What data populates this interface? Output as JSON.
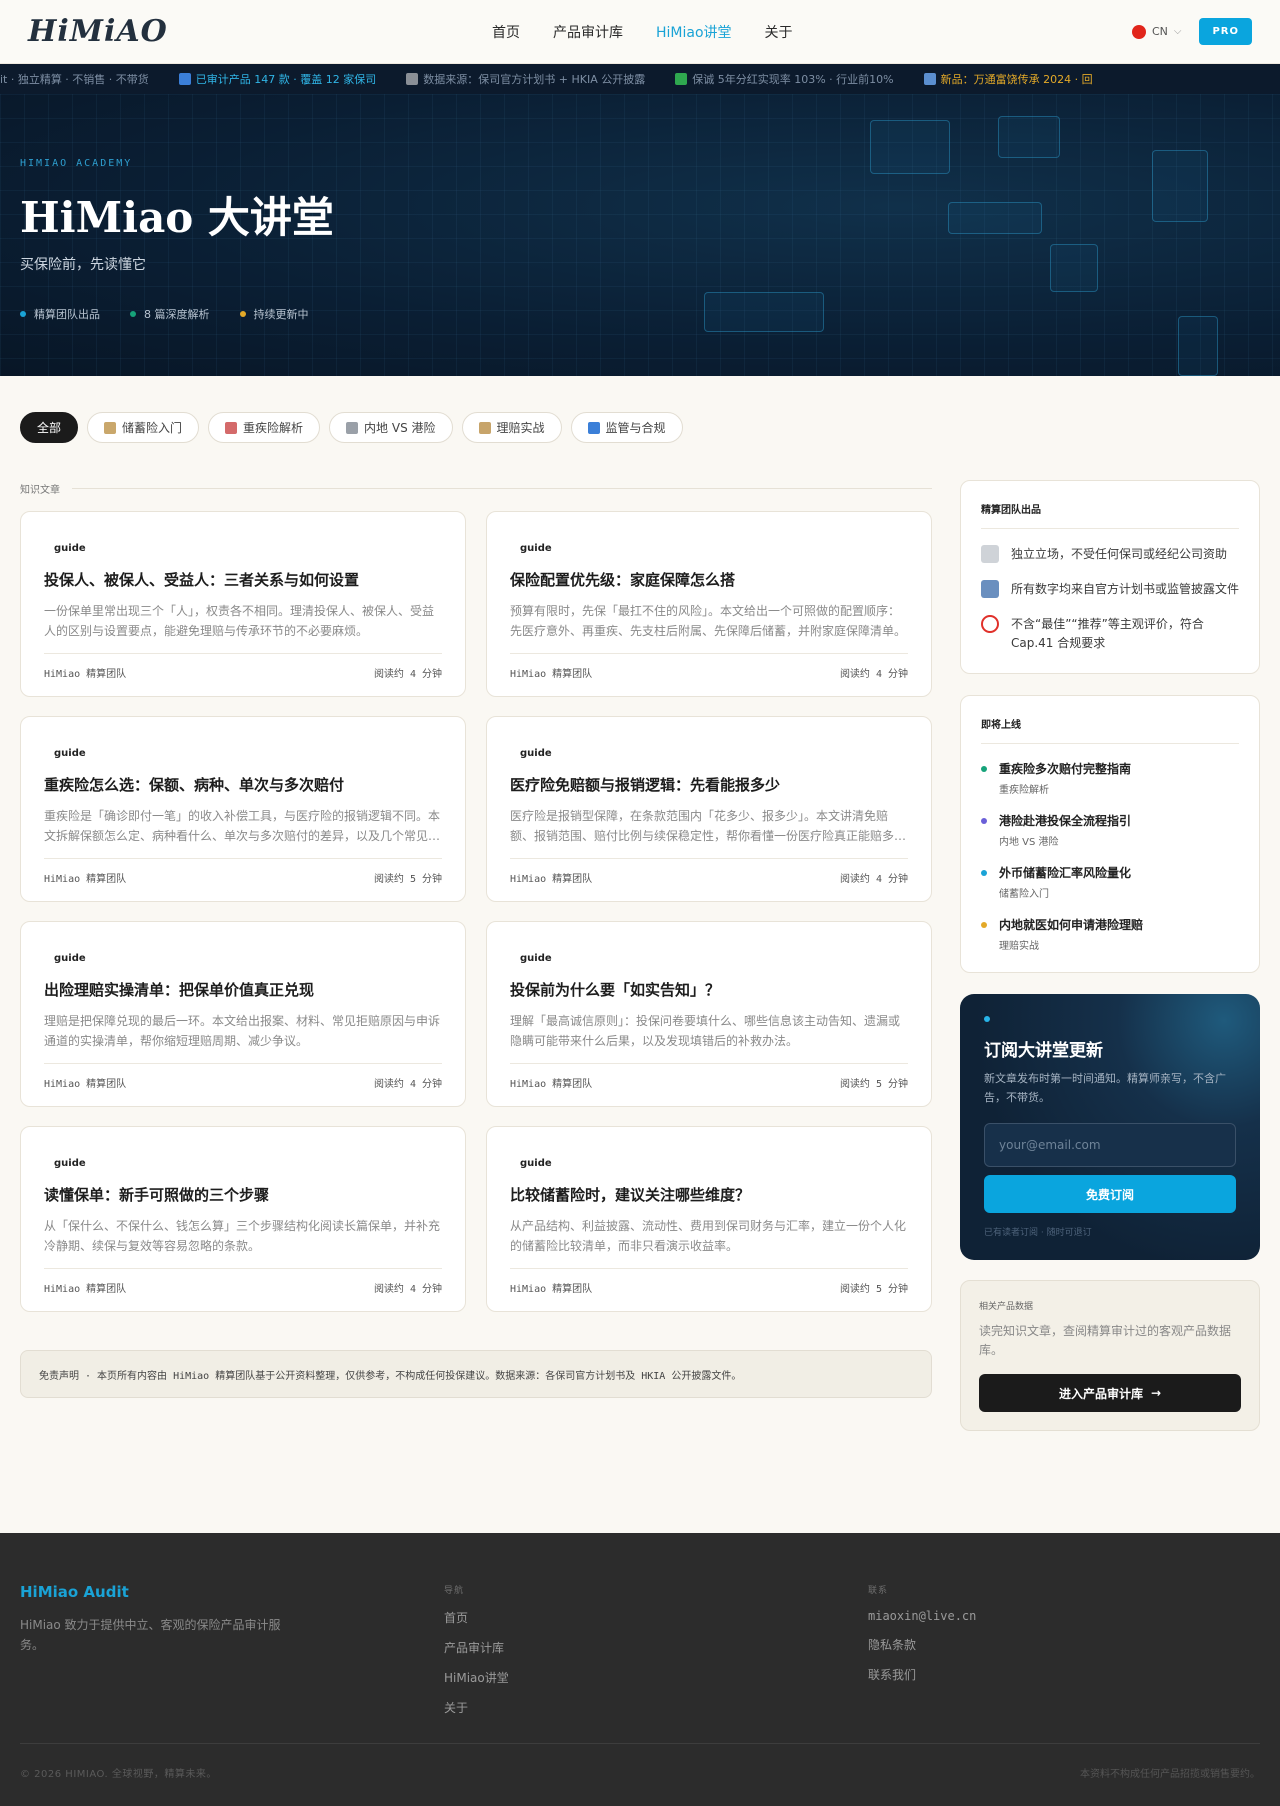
{
  "header": {
    "logo": "HiMiAO",
    "nav": [
      "首页",
      "产品审计库",
      "HiMiao讲堂",
      "关于"
    ],
    "active_nav": "HiMiao讲堂",
    "lang": "CN",
    "pro": "PRO"
  },
  "ticker": {
    "item1": "udit · 独立精算 · 不销售 · 不带货",
    "item2": "已审计产品 147 款 · 覆盖 12 家保司",
    "item3": "数据来源：保司官方计划书 + HKIA 公开披露",
    "item4": "保诚 5年分红实现率 103% · 行业前10%",
    "item5": "新品：万通富饶传承 2024 · 回"
  },
  "hero": {
    "kicker": "HIMIAO ACADEMY",
    "title": "HiMiao 大讲堂",
    "subtitle": "买保险前，先读懂它",
    "stats": [
      "精算团队出品",
      "8 篇深度解析",
      "持续更新中"
    ]
  },
  "filters": [
    "全部",
    "储蓄险入门",
    "重疾险解析",
    "内地 VS 港险",
    "理赔实战",
    "监管与合规"
  ],
  "section_label": "知识文章",
  "articles": [
    {
      "tag": "guide",
      "title": "投保人、被保人、受益人：三者关系与如何设置",
      "desc": "一份保单里常出现三个「人」，权责各不相同。理清投保人、被保人、受益人的区别与设置要点，能避免理赔与传承环节的不必要麻烦。",
      "author": "HiMiao 精算团队",
      "read": "阅读约 4 分钟"
    },
    {
      "tag": "guide",
      "title": "保险配置优先级：家庭保障怎么搭",
      "desc": "预算有限时，先保「最扛不住的风险」。本文给出一个可照做的配置顺序：先医疗意外、再重疾、先支柱后附属、先保障后储蓄，并附家庭保障清单。",
      "author": "HiMiao 精算团队",
      "read": "阅读约 4 分钟"
    },
    {
      "tag": "guide",
      "title": "重疾险怎么选：保额、病种、单次与多次赔付",
      "desc": "重疾险是「确诊即付一笔」的收入补偿工具，与医疗险的报销逻辑不同。本文拆解保额怎么定、病种看什么、单次与多次赔付的差异，以及几个常见误区。",
      "author": "HiMiao 精算团队",
      "read": "阅读约 5 分钟"
    },
    {
      "tag": "guide",
      "title": "医疗险免赔额与报销逻辑：先看能报多少",
      "desc": "医疗险是报销型保障，在条款范围内「花多少、报多少」。本文讲清免赔额、报销范围、赔付比例与续保稳定性，帮你看懂一份医疗险真正能赔多少。",
      "author": "HiMiao 精算团队",
      "read": "阅读约 4 分钟"
    },
    {
      "tag": "guide",
      "title": "出险理赔实操清单：把保单价值真正兑现",
      "desc": "理赔是把保障兑现的最后一环。本文给出报案、材料、常见拒赔原因与申诉通道的实操清单，帮你缩短理赔周期、减少争议。",
      "author": "HiMiao 精算团队",
      "read": "阅读约 4 分钟"
    },
    {
      "tag": "guide",
      "title": "投保前为什么要「如实告知」？",
      "desc": "理解「最高诚信原则」：投保问卷要填什么、哪些信息该主动告知、遗漏或隐瞒可能带来什么后果，以及发现填错后的补救办法。",
      "author": "HiMiao 精算团队",
      "read": "阅读约 5 分钟"
    },
    {
      "tag": "guide",
      "title": "读懂保单：新手可照做的三个步骤",
      "desc": "从「保什么、不保什么、钱怎么算」三个步骤结构化阅读长篇保单，并补充冷静期、续保与复效等容易忽略的条款。",
      "author": "HiMiao 精算团队",
      "read": "阅读约 4 分钟"
    },
    {
      "tag": "guide",
      "title": "比较储蓄险时，建议关注哪些维度？",
      "desc": "从产品结构、利益披露、流动性、费用到保司财务与汇率，建立一份个人化的储蓄险比较清单，而非只看演示收益率。",
      "author": "HiMiao 精算团队",
      "read": "阅读约 5 分钟"
    }
  ],
  "disclaimer": "免责声明 · 本页所有内容由 HiMiao 精算团队基于公开资料整理，仅供参考，不构成任何投保建议。数据来源：各保司官方计划书及 HKIA 公开披露文件。",
  "sidebar": {
    "team_title": "精算团队出品",
    "benefits": [
      "独立立场，不受任何保司或经纪公司资助",
      "所有数字均来自官方计划书或监管披露文件",
      "不含“最佳”“推荐”等主观评价，符合 Cap.41 合规要求"
    ],
    "upcoming_title": "即将上线",
    "upcoming": [
      {
        "title": "重疾险多次赔付完整指南",
        "cat": "重疾险解析",
        "color": "#16a37a"
      },
      {
        "title": "港险赴港投保全流程指引",
        "cat": "内地 VS 港险",
        "color": "#6a5fd8"
      },
      {
        "title": "外币储蓄险汇率风险量化",
        "cat": "储蓄险入门",
        "color": "#1aa3d6"
      },
      {
        "title": "内地就医如何申请港险理赔",
        "cat": "理赔实战",
        "color": "#e3a928"
      }
    ],
    "subscribe": {
      "title": "订阅大讲堂更新",
      "desc": "新文章发布时第一时间通知。精算师亲写，不含广告，不带货。",
      "placeholder": "your@email.com",
      "button": "免费订阅",
      "note": "已有读者订阅 · 随时可退订"
    },
    "related": {
      "title": "相关产品数据",
      "desc": "读完知识文章，查阅精算审计过的客观产品数据库。",
      "button": "进入产品审计库",
      "arrow": "→"
    }
  },
  "footer": {
    "brand": "HiMiao Audit",
    "desc": "HiMiao 致力于提供中立、客观的保险产品审计服务。",
    "nav_head": "导航",
    "nav": [
      "首页",
      "产品审计库",
      "HiMiao讲堂",
      "关于"
    ],
    "contact_head": "联系",
    "contact": [
      "miaoxin@live.cn",
      "隐私条款",
      "联系我们"
    ],
    "copyright": "© 2026 HIMIAO. 全球视野，精算未来。",
    "right_note": "本资料不构成任何产品招揽或销售要约。"
  }
}
